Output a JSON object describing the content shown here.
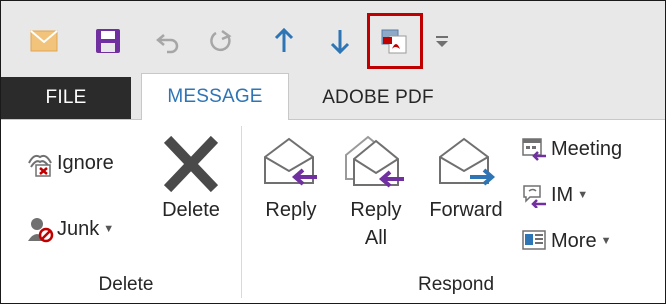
{
  "quick_access": {
    "buttons": [
      "mail-icon",
      "save-icon",
      "undo-icon",
      "redo-icon",
      "previous-item-icon",
      "next-item-icon",
      "create-pdf-icon"
    ],
    "dropdown": "customize-toolbar-icon"
  },
  "tabs": {
    "file": "FILE",
    "message": "MESSAGE",
    "adobe_pdf": "ADOBE PDF"
  },
  "groups": {
    "delete": {
      "label": "Delete",
      "ignore": "Ignore",
      "junk": "Junk",
      "delete_button": "Delete"
    },
    "respond": {
      "label": "Respond",
      "reply": "Reply",
      "reply_all_line1": "Reply",
      "reply_all_line2": "All",
      "forward": "Forward",
      "meeting": "Meeting",
      "im": "IM",
      "more": "More"
    }
  },
  "colors": {
    "file_tab": "#2b2b2b",
    "active_tab_text": "#2e75b6",
    "highlight_box": "#c00000",
    "arrow_purple": "#7030a0",
    "arrow_blue": "#2e75b6"
  }
}
